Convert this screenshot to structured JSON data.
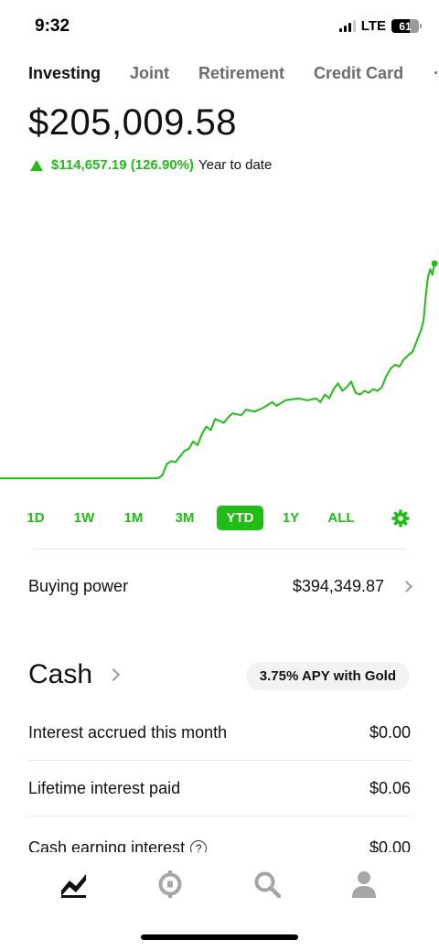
{
  "status": {
    "time": "9:32",
    "network": "LTE",
    "battery": "61"
  },
  "accounts": {
    "tabs": [
      {
        "label": "Investing"
      },
      {
        "label": "Joint"
      },
      {
        "label": "Retirement"
      },
      {
        "label": "Credit Card"
      }
    ],
    "active": "Investing"
  },
  "portfolio": {
    "balance": "$205,009.58",
    "change": "$114,657.19 (126.90%)",
    "period": "Year to date",
    "up_color": "#1fbd16"
  },
  "chart_data": {
    "type": "line",
    "x_domain": [
      0,
      100
    ],
    "y_domain": [
      86000,
      210000
    ],
    "series": [
      {
        "values": [
          [
            0,
            90352
          ],
          [
            5,
            90352
          ],
          [
            10,
            90352
          ],
          [
            15,
            90352
          ],
          [
            20,
            90352
          ],
          [
            25,
            90352
          ],
          [
            30,
            90352
          ],
          [
            36,
            90352
          ],
          [
            37,
            92000
          ],
          [
            38,
            98000
          ],
          [
            39,
            99500
          ],
          [
            40,
            99000
          ],
          [
            42,
            105000
          ],
          [
            43,
            106000
          ],
          [
            44,
            110000
          ],
          [
            45,
            108000
          ],
          [
            46,
            114000
          ],
          [
            47,
            118000
          ],
          [
            48,
            116000
          ],
          [
            49,
            122000
          ],
          [
            50,
            121000
          ],
          [
            51,
            120000
          ],
          [
            52,
            123000
          ],
          [
            53,
            125000
          ],
          [
            55,
            124000
          ],
          [
            56,
            127000
          ],
          [
            58,
            126000
          ],
          [
            60,
            128000
          ],
          [
            62,
            131000
          ],
          [
            63,
            129000
          ],
          [
            65,
            132000
          ],
          [
            68,
            133000
          ],
          [
            70,
            132000
          ],
          [
            72,
            133000
          ],
          [
            73,
            131000
          ],
          [
            74,
            135000
          ],
          [
            75,
            133000
          ],
          [
            76,
            138000
          ],
          [
            77,
            141000
          ],
          [
            78,
            137000
          ],
          [
            79,
            139000
          ],
          [
            80,
            142000
          ],
          [
            81,
            136000
          ],
          [
            82,
            135000
          ],
          [
            83,
            137000
          ],
          [
            84,
            136000
          ],
          [
            85,
            138000
          ],
          [
            86,
            137000
          ],
          [
            87,
            139000
          ],
          [
            88,
            145000
          ],
          [
            89,
            149000
          ],
          [
            90,
            151000
          ],
          [
            91,
            150000
          ],
          [
            92,
            154000
          ],
          [
            93,
            156000
          ],
          [
            94,
            158000
          ],
          [
            95,
            164000
          ],
          [
            96,
            170000
          ],
          [
            96.5,
            175000
          ],
          [
            97,
            188000
          ],
          [
            97.5,
            198000
          ],
          [
            98,
            202000
          ],
          [
            98.5,
            199000
          ],
          [
            99,
            205009
          ]
        ]
      }
    ]
  },
  "ranges": {
    "items": [
      "1D",
      "1W",
      "1M",
      "3M",
      "YTD",
      "1Y",
      "ALL"
    ],
    "active": "YTD"
  },
  "buying_power": {
    "label": "Buying power",
    "value": "$394,349.87"
  },
  "cash": {
    "title": "Cash",
    "apy_badge": "3.75% APY with Gold",
    "rows": [
      {
        "label": "Interest accrued this month",
        "value": "$0.00"
      },
      {
        "label": "Lifetime interest paid",
        "value": "$0.06"
      },
      {
        "label": "Cash earning interest",
        "value": "$0.00"
      }
    ]
  },
  "nav": {
    "icons": [
      "chart-icon",
      "crypto-icon",
      "search-icon",
      "account-icon"
    ]
  }
}
